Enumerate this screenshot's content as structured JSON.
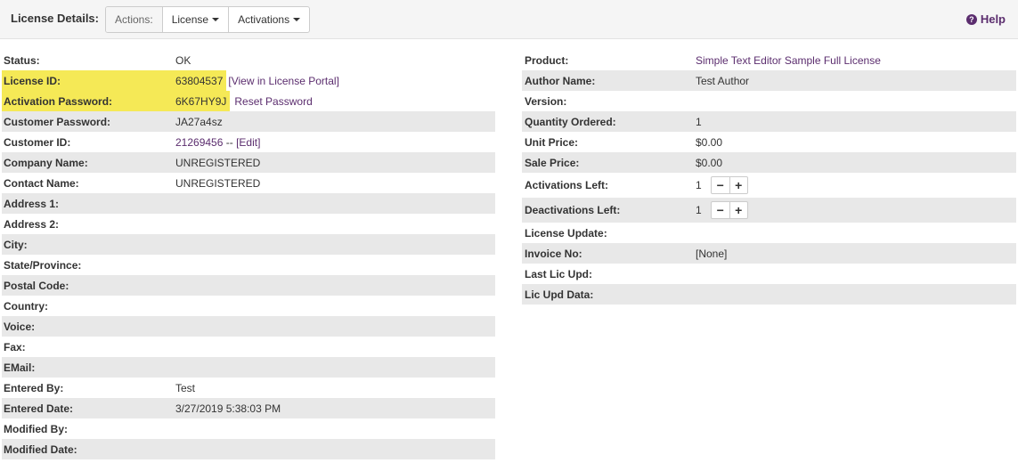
{
  "toolbar": {
    "title": "License Details:",
    "actions_label": "Actions:",
    "license_label": "License",
    "activations_label": "Activations",
    "help_label": "Help"
  },
  "left": {
    "status": {
      "label": "Status:",
      "value": "OK"
    },
    "license_id": {
      "label": "License ID:",
      "value": "63804537",
      "link": "[View in License Portal]"
    },
    "activation_password": {
      "label": "Activation Password:",
      "value": "6K67HY9J",
      "link": "Reset Password"
    },
    "customer_password": {
      "label": "Customer Password:",
      "value": "JA27a4sz"
    },
    "customer_id": {
      "label": "Customer ID:",
      "value": "21269456",
      "sep": " -- ",
      "link": "[Edit]"
    },
    "company_name": {
      "label": "Company Name:",
      "value": "UNREGISTERED"
    },
    "contact_name": {
      "label": "Contact Name:",
      "value": "UNREGISTERED"
    },
    "address1": {
      "label": "Address 1:",
      "value": ""
    },
    "address2": {
      "label": "Address 2:",
      "value": ""
    },
    "city": {
      "label": "City:",
      "value": ""
    },
    "state": {
      "label": "State/Province:",
      "value": ""
    },
    "postal": {
      "label": "Postal Code:",
      "value": ""
    },
    "country": {
      "label": "Country:",
      "value": ""
    },
    "voice": {
      "label": "Voice:",
      "value": ""
    },
    "fax": {
      "label": "Fax:",
      "value": ""
    },
    "email": {
      "label": "EMail:",
      "value": ""
    },
    "entered_by": {
      "label": "Entered By:",
      "value": "Test"
    },
    "entered_date": {
      "label": "Entered Date:",
      "value": "3/27/2019 5:38:03 PM"
    },
    "modified_by": {
      "label": "Modified By:",
      "value": ""
    },
    "modified_date": {
      "label": "Modified Date:",
      "value": ""
    }
  },
  "right": {
    "product": {
      "label": "Product:",
      "value": "Simple Text Editor Sample Full License"
    },
    "author": {
      "label": "Author Name:",
      "value": "Test Author"
    },
    "version": {
      "label": "Version:",
      "value": ""
    },
    "qty": {
      "label": "Quantity Ordered:",
      "value": "1"
    },
    "unit_price": {
      "label": "Unit Price:",
      "value": "$0.00"
    },
    "sale_price": {
      "label": "Sale Price:",
      "value": "$0.00"
    },
    "activations_left": {
      "label": "Activations Left:",
      "value": "1"
    },
    "deactivations_left": {
      "label": "Deactivations Left:",
      "value": "1"
    },
    "license_update": {
      "label": "License Update:",
      "value": ""
    },
    "invoice": {
      "label": "Invoice No:",
      "value": "[None]"
    },
    "last_lic_upd": {
      "label": "Last Lic Upd:",
      "value": ""
    },
    "lic_upd_data": {
      "label": "Lic Upd Data:",
      "value": ""
    }
  },
  "stepper": {
    "minus": "−",
    "plus": "+"
  },
  "colors": {
    "link": "#5b2d6e",
    "highlight": "#f5e956",
    "stripe": "#e8e8e8"
  }
}
